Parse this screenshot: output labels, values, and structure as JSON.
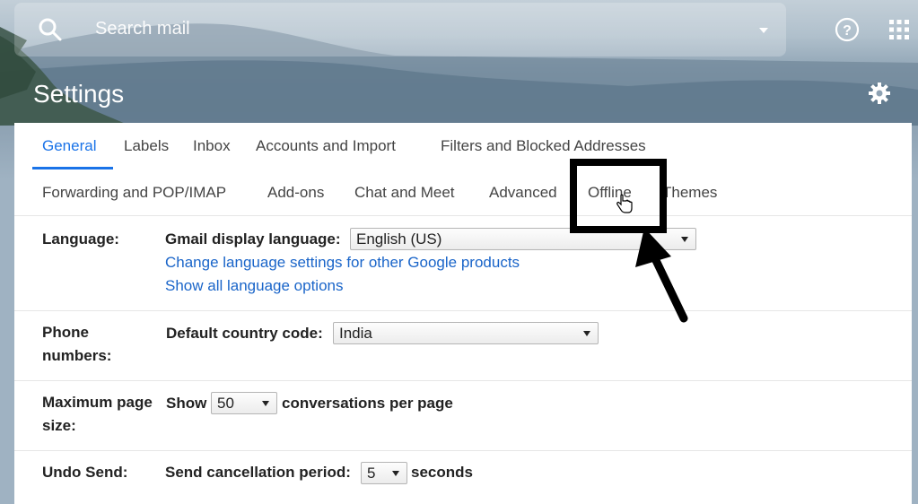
{
  "search": {
    "placeholder": "Search mail",
    "search_icon": "search-icon",
    "options_icon": "caret-down-icon"
  },
  "header": {
    "help_icon": "help-icon",
    "apps_icon": "apps-grid-icon",
    "title": "Settings",
    "settings_icon": "gear-icon"
  },
  "tabs": {
    "row1": [
      {
        "label": "General",
        "active": true
      },
      {
        "label": "Labels",
        "active": false
      },
      {
        "label": "Inbox",
        "active": false
      },
      {
        "label": "Accounts and Import",
        "active": false
      },
      {
        "label": "Filters and Blocked Addresses",
        "active": false
      }
    ],
    "row2": [
      {
        "label": "Forwarding and POP/IMAP",
        "active": false
      },
      {
        "label": "Add-ons",
        "active": false
      },
      {
        "label": "Chat and Meet",
        "active": false
      },
      {
        "label": "Advanced",
        "active": false
      },
      {
        "label": "Offline",
        "active": false,
        "highlighted": true
      },
      {
        "label": "Themes",
        "active": false
      }
    ]
  },
  "settings": {
    "language": {
      "label": "Language:",
      "field_label": "Gmail display language:",
      "value": "English (US)",
      "link1": "Change language settings for other Google products",
      "link2": "Show all language options"
    },
    "phone": {
      "label_line1": "Phone",
      "label_line2": "numbers:",
      "field_label": "Default country code:",
      "value": "India"
    },
    "page_size": {
      "label_line1": "Maximum page",
      "label_line2": "size:",
      "prefix": "Show",
      "value": "50",
      "suffix": "conversations per page"
    },
    "undo_send": {
      "label": "Undo Send:",
      "field_label": "Send cancellation period:",
      "value": "5",
      "suffix": "seconds"
    }
  },
  "annotation": {
    "highlight_color": "#000000",
    "target": "Offline"
  },
  "colors": {
    "accent": "#1a73e8",
    "link": "#1a65c9",
    "text": "#222222"
  }
}
